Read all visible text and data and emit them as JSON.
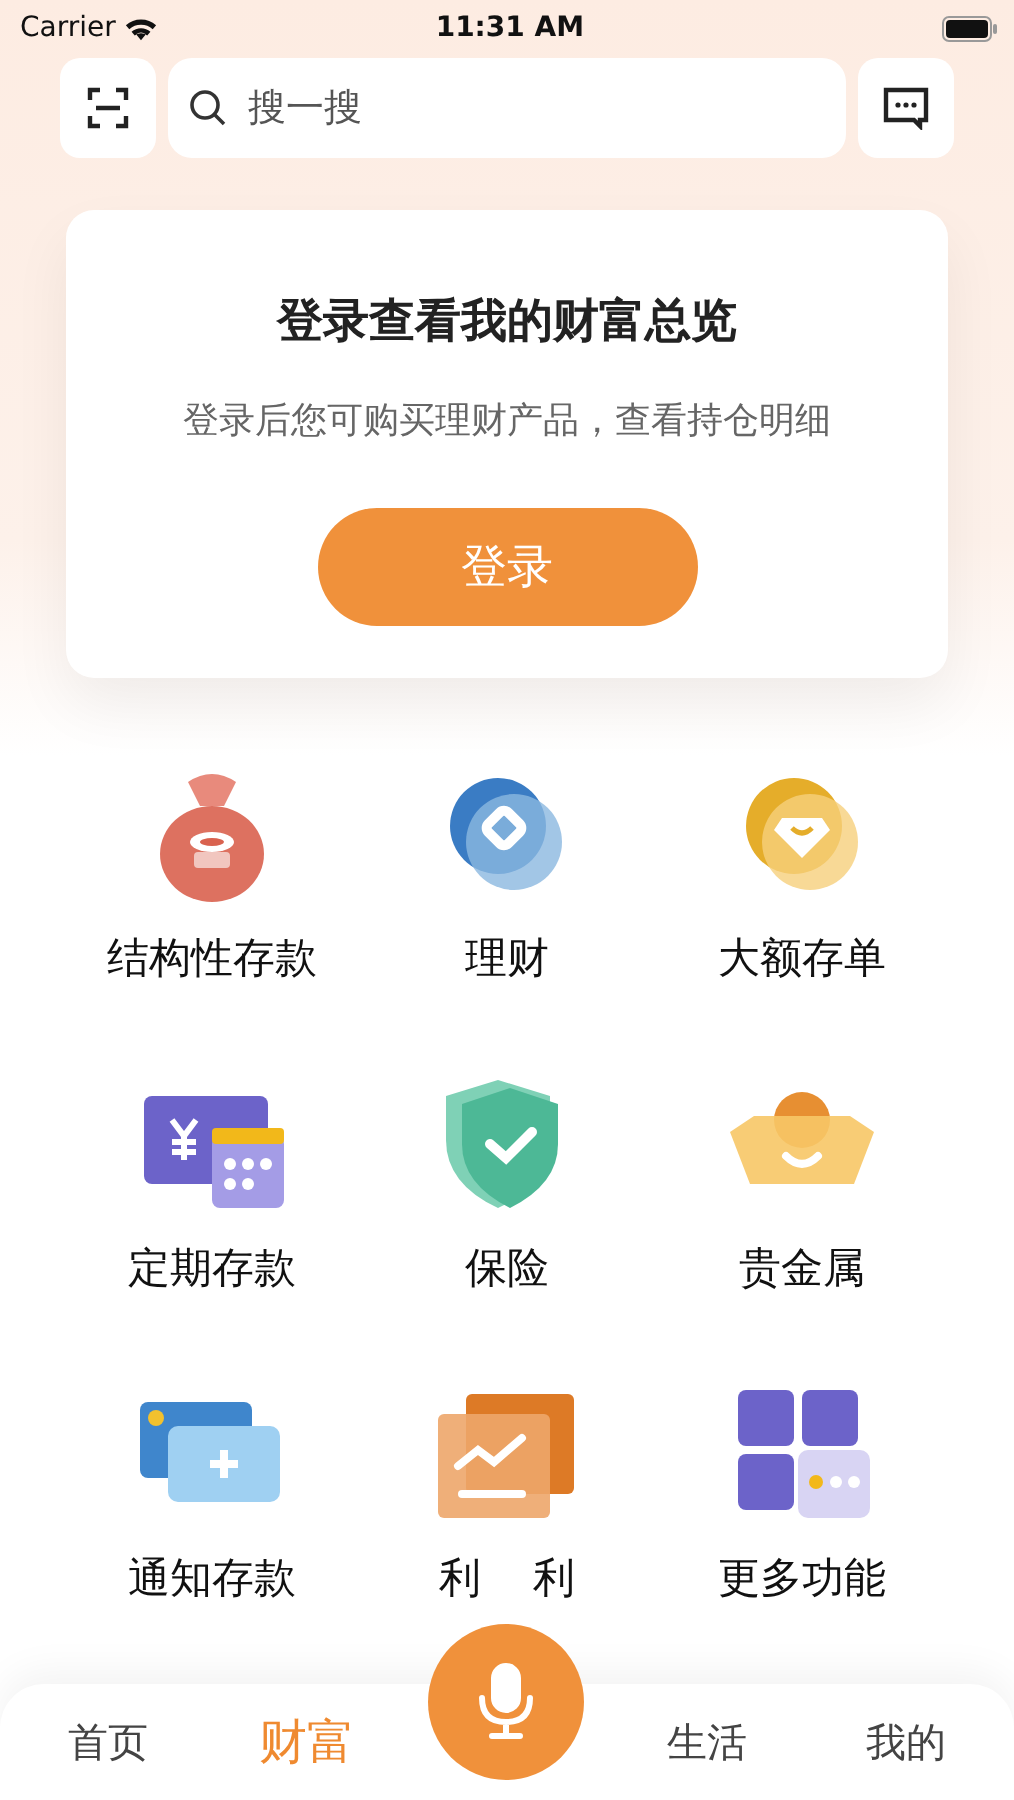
{
  "status_bar": {
    "carrier": "Carrier",
    "time": "11:31 AM"
  },
  "search": {
    "placeholder": "搜一搜"
  },
  "login_card": {
    "title": "登录查看我的财富总览",
    "subtitle": "登录后您可购买理财产品，查看持仓明细",
    "button": "登录"
  },
  "features": [
    {
      "label": "结构性存款",
      "kind": "bag"
    },
    {
      "label": "理财",
      "kind": "coin"
    },
    {
      "label": "大额存单",
      "kind": "diamond"
    },
    {
      "label": "定期存款",
      "kind": "calendar"
    },
    {
      "label": "保险",
      "kind": "shield"
    },
    {
      "label": "贵金属",
      "kind": "ingot"
    },
    {
      "label": "通知存款",
      "kind": "card"
    },
    {
      "label": "利 利",
      "kind": "chart"
    },
    {
      "label": "更多功能",
      "kind": "grid"
    }
  ],
  "tabs": [
    {
      "label": "首页",
      "selected": false
    },
    {
      "label": "财富",
      "selected": true
    },
    {
      "label": "生活",
      "selected": false
    },
    {
      "label": "我的",
      "selected": false
    }
  ]
}
